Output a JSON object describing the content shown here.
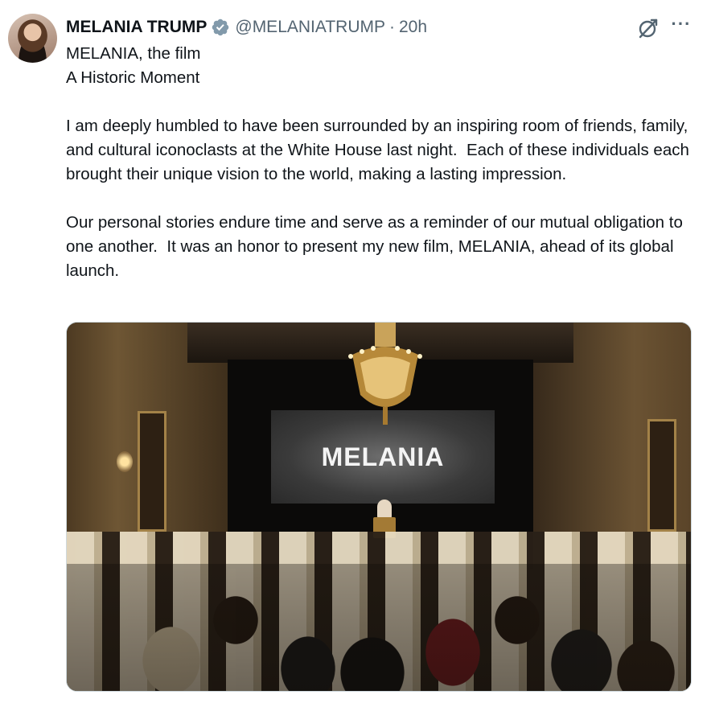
{
  "author": {
    "name": "MELANIA TRUMP",
    "handle": "@MELANIATRUMP",
    "separator": "·",
    "timestamp": "20h"
  },
  "icons": {
    "avatar": "profile-photo",
    "verified": "verified-badge-icon",
    "grok": "grok-icon",
    "more": "more-options-icon"
  },
  "more_glyph": "···",
  "tweet": {
    "paragraphs": [
      "MELANIA, the film\nA Historic Moment",
      "I am deeply humbled to have been surrounded by an inspiring room of friends, family, and cultural iconoclasts at the White House last night.  Each of these individuals each brought their unique vision to the world, making a lasting impression.",
      "Our personal stories endure time and serve as a reminder of our mutual obligation to one another.  It was an honor to present my new film, MELANIA, ahead of its global launch."
    ]
  },
  "media": {
    "screen_text": "MELANIA"
  },
  "colors": {
    "text": "#0f1419",
    "secondary": "#536471",
    "verified_badge": "#829aab",
    "border": "#cfd9de"
  }
}
